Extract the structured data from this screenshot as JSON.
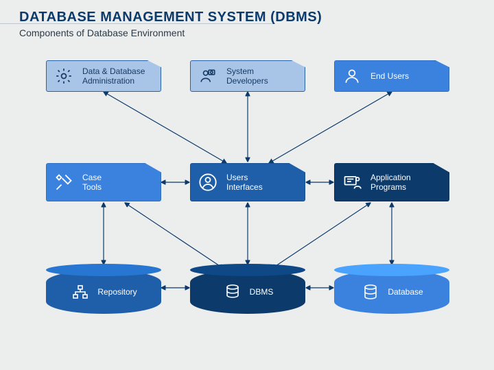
{
  "title": "DATABASE MANAGEMENT SYSTEM (DBMS)",
  "subtitle": "Components of Database Environment",
  "nodes": {
    "admin": {
      "label": "Data & Database\nAdministration"
    },
    "developers": {
      "label": "System\nDevelopers"
    },
    "endusers": {
      "label": "End Users"
    },
    "casetools": {
      "label": "Case\nTools"
    },
    "ui": {
      "label": "Users\nInterfaces"
    },
    "apps": {
      "label": "Application\nPrograms"
    },
    "repository": {
      "label": "Repository"
    },
    "dbms": {
      "label": "DBMS"
    },
    "database": {
      "label": "Database"
    }
  }
}
